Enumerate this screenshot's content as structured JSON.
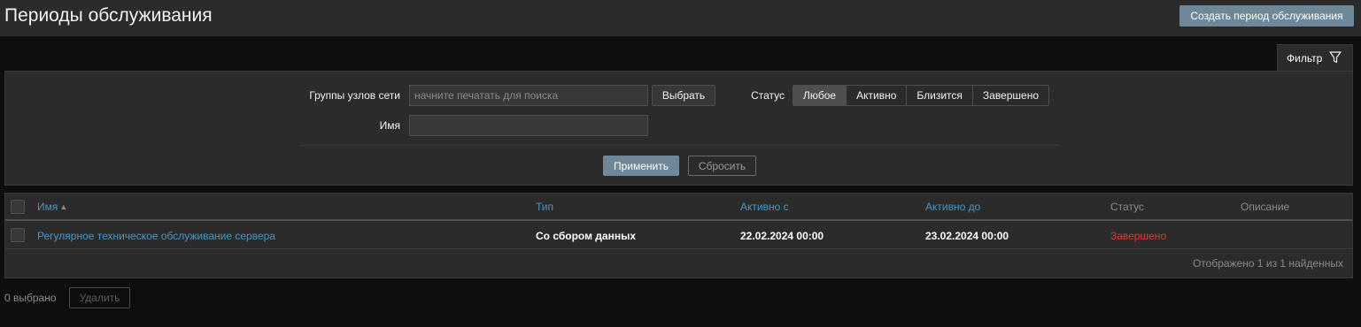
{
  "header": {
    "title": "Периоды обслуживания",
    "create_button": "Создать период обслуживания"
  },
  "filter": {
    "tab_label": "Фильтр",
    "host_groups_label": "Группы узлов сети",
    "host_groups_placeholder": "начните печатать для поиска",
    "select_button": "Выбрать",
    "name_label": "Имя",
    "name_value": "",
    "status_label": "Статус",
    "status_options": [
      "Любое",
      "Активно",
      "Близится",
      "Завершено"
    ],
    "status_selected": "Любое",
    "apply_button": "Применить",
    "reset_button": "Сбросить"
  },
  "table": {
    "columns": {
      "name": "Имя",
      "type": "Тип",
      "active_since": "Активно с",
      "active_till": "Активно до",
      "status": "Статус",
      "description": "Описание"
    },
    "rows": [
      {
        "name": "Регулярное техническое обслуживание сервера",
        "type": "Со сбором данных",
        "active_since": "22.02.2024 00:00",
        "active_till": "23.02.2024 00:00",
        "status": "Завершено",
        "description": ""
      }
    ],
    "footer": "Отображено 1 из 1 найденных"
  },
  "bottom": {
    "selected_count": "0 выбрано",
    "delete_button": "Удалить"
  },
  "colors": {
    "link": "#4796c4",
    "status_finished": "#e33734",
    "primary_button": "#6e8799"
  }
}
